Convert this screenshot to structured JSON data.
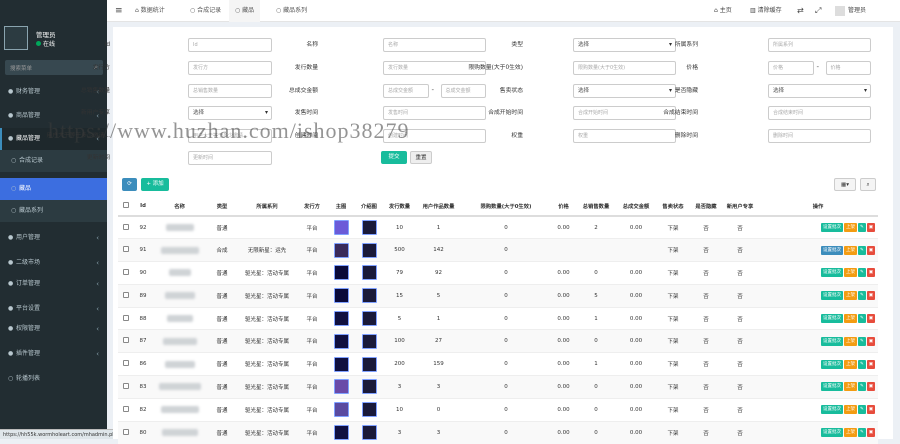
{
  "sidebar": {
    "user_name": "管理员",
    "user_status": "在线",
    "search_placeholder": "搜索菜单",
    "menu": [
      {
        "label": "财务管理",
        "icon": "●"
      },
      {
        "label": "商品管理",
        "icon": "●"
      },
      {
        "label": "藏品管理",
        "icon": "●"
      },
      {
        "label": "合成记录",
        "icon": "○"
      },
      {
        "label": "藏品",
        "icon": "○"
      },
      {
        "label": "藏品系列",
        "icon": "○"
      },
      {
        "label": "用户管理",
        "icon": "●"
      },
      {
        "label": "二级市场",
        "icon": "●"
      },
      {
        "label": "订单管理",
        "icon": "●"
      },
      {
        "label": "平台设置",
        "icon": "●"
      },
      {
        "label": "权限管理",
        "icon": "●"
      },
      {
        "label": "插件管理",
        "icon": "●"
      },
      {
        "label": "轮播列表",
        "icon": "○"
      }
    ]
  },
  "status_url": "https://hh55k.wormholeart.com/mhadmin.php/collection?ref=addtabs",
  "topbar": {
    "menu_icon": "≡",
    "tabs": [
      "数据统计",
      "合成记录",
      "藏品",
      "藏品系列"
    ],
    "right": [
      "主页",
      "清除缓存",
      "管理员"
    ]
  },
  "watermark": "https://www.huzhan.com/ishop38279",
  "form": {
    "fields": [
      {
        "label": "Id",
        "placeholder": "Id",
        "type": "input"
      },
      {
        "label": "名称",
        "placeholder": "名称",
        "type": "input"
      },
      {
        "label": "类型",
        "value": "选择",
        "type": "select"
      },
      {
        "label": "所属系列",
        "placeholder": "所属系列",
        "type": "input"
      },
      {
        "label": "发行方",
        "placeholder": "发行方",
        "type": "input"
      },
      {
        "label": "发行数量",
        "placeholder": "发行数量",
        "type": "input"
      },
      {
        "label": "限购数量(大于0生效)",
        "placeholder": "限购数量(大于0生效)",
        "type": "input"
      },
      {
        "label": "价格",
        "placeholder": "价格",
        "placeholder2": "价格",
        "type": "range"
      },
      {
        "label": "总销售数量",
        "placeholder": "总销售数量",
        "type": "input"
      },
      {
        "label": "总成交金额",
        "placeholder": "总成交金额",
        "placeholder2": "总成交金额",
        "type": "range"
      },
      {
        "label": "售卖状态",
        "value": "选择",
        "type": "select"
      },
      {
        "label": "是否隐藏",
        "value": "选择",
        "type": "select"
      },
      {
        "label": "新用户专享",
        "value": "选择",
        "type": "select"
      },
      {
        "label": "发售时间",
        "placeholder": "发售时间",
        "type": "input"
      },
      {
        "label": "合成开始时间",
        "placeholder": "合成开始时间",
        "type": "input"
      },
      {
        "label": "合成结束时间",
        "placeholder": "合成结束时间",
        "type": "input"
      },
      {
        "label": "用户大于等于多少邀请...",
        "placeholder": "用户大于等于多少邀请...",
        "type": "input"
      },
      {
        "label": "创建时间",
        "placeholder": "创建时间",
        "type": "input"
      },
      {
        "label": "权重",
        "placeholder": "权重",
        "type": "input"
      },
      {
        "label": "删除时间",
        "placeholder": "删除时间",
        "type": "input"
      },
      {
        "label": "更新时间",
        "placeholder": "更新时间",
        "type": "input"
      }
    ],
    "submit_label": "提交",
    "reset_label": "重置"
  },
  "toolbar": {
    "add_label": "添加"
  },
  "table": {
    "headers": [
      "Id",
      "名称",
      "类型",
      "所属系列",
      "发行方",
      "主图",
      "介绍图",
      "发行数量",
      "用户作品数量",
      "限购数量(大于0生效)",
      "价格",
      "总销售数量",
      "总成交金额",
      "售卖状态",
      "是否隐藏",
      "新用户专享",
      "操作"
    ],
    "rows": [
      {
        "id": "92",
        "type": "普通",
        "series": "",
        "issuer": "平台",
        "qty": "10",
        "user_qty": "1",
        "limit": "0",
        "price": "0.00",
        "sold": "2",
        "amount": "0.00",
        "status": "下架",
        "hidden": "否",
        "new_user": "否"
      },
      {
        "id": "91",
        "type": "合成",
        "series": "无限新星：运先",
        "issuer": "平台",
        "qty": "500",
        "user_qty": "142",
        "limit": "0",
        "price": "",
        "sold": "",
        "amount": "",
        "status": "下架",
        "hidden": "否",
        "new_user": "否"
      },
      {
        "id": "90",
        "type": "普通",
        "series": "驱光星：活动专属",
        "issuer": "平台",
        "qty": "79",
        "user_qty": "92",
        "limit": "0",
        "price": "0.00",
        "sold": "0",
        "amount": "0.00",
        "status": "下架",
        "hidden": "否",
        "new_user": "否"
      },
      {
        "id": "89",
        "type": "普通",
        "series": "驱光星：活动专属",
        "issuer": "平台",
        "qty": "15",
        "user_qty": "5",
        "limit": "0",
        "price": "0.00",
        "sold": "5",
        "amount": "0.00",
        "status": "下架",
        "hidden": "否",
        "new_user": "否"
      },
      {
        "id": "88",
        "type": "普通",
        "series": "驱光星：活动专属",
        "issuer": "平台",
        "qty": "5",
        "user_qty": "1",
        "limit": "0",
        "price": "0.00",
        "sold": "1",
        "amount": "0.00",
        "status": "下架",
        "hidden": "否",
        "new_user": "否"
      },
      {
        "id": "87",
        "type": "普通",
        "series": "驱光星：活动专属",
        "issuer": "平台",
        "qty": "100",
        "user_qty": "27",
        "limit": "0",
        "price": "0.00",
        "sold": "0",
        "amount": "0.00",
        "status": "下架",
        "hidden": "否",
        "new_user": "否"
      },
      {
        "id": "86",
        "type": "普通",
        "series": "驱光星：活动专属",
        "issuer": "平台",
        "qty": "200",
        "user_qty": "159",
        "limit": "0",
        "price": "0.00",
        "sold": "1",
        "amount": "0.00",
        "status": "下架",
        "hidden": "否",
        "new_user": "否"
      },
      {
        "id": "83",
        "type": "普通",
        "series": "驱光星：活动专属",
        "issuer": "平台",
        "qty": "3",
        "user_qty": "3",
        "limit": "0",
        "price": "0.00",
        "sold": "0",
        "amount": "0.00",
        "status": "下架",
        "hidden": "否",
        "new_user": "否"
      },
      {
        "id": "82",
        "type": "普通",
        "series": "驱光星：活动专属",
        "issuer": "平台",
        "qty": "10",
        "user_qty": "0",
        "limit": "0",
        "price": "0.00",
        "sold": "0",
        "amount": "0.00",
        "status": "下架",
        "hidden": "否",
        "new_user": "否"
      },
      {
        "id": "80",
        "type": "普通",
        "series": "驱光星：活动专属",
        "issuer": "平台",
        "qty": "3",
        "user_qty": "3",
        "limit": "0",
        "price": "0.00",
        "sold": "0",
        "amount": "0.00",
        "status": "下架",
        "hidden": "否",
        "new_user": "否"
      }
    ],
    "action_labels": [
      "设置批次",
      "上架"
    ],
    "alt_action_label": "设置批次"
  },
  "colors": {
    "sidebar_bg": "#222d32",
    "active": "#3c6ee0",
    "green": "#18bc9c",
    "orange": "#f39c12",
    "red": "#e74c3c",
    "blue": "#3c8dbc"
  }
}
